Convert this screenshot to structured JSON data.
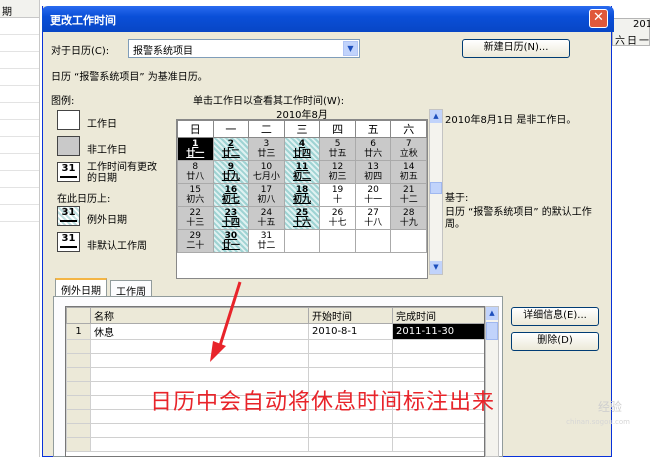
{
  "background": {
    "left_header": "期",
    "right_header_top": "201",
    "right_header_days": [
      "六",
      "日",
      "一"
    ]
  },
  "dialog": {
    "title": "更改工作时间",
    "close_glyph": "✕",
    "for_calendar_label": "对于日历(C):",
    "calendar_select_value": "报警系统项目",
    "new_calendar_button": "新建日历(N)...",
    "base_calendar_text": "日历 “报警系统项目” 为基准日历。",
    "legend_title": "图例:",
    "legend": {
      "working_day": "工作日",
      "nonworking_day": "非工作日",
      "edited_hours": "工作时间有更改的日期",
      "on_this_calendar": "在此日历上:",
      "exception_day": "例外日期",
      "nondefault_week": "非默认工作周",
      "marker": "31"
    },
    "click_instruction": "单击工作日以查看其工作时间(W):",
    "month_title": "2010年8月",
    "weekdays": [
      "日",
      "一",
      "二",
      "三",
      "四",
      "五",
      "六"
    ],
    "weeks": [
      [
        {
          "d": "1",
          "l": "廿一",
          "s": "black"
        },
        {
          "d": "2",
          "l": "廿二",
          "s": "teal"
        },
        {
          "d": "3",
          "l": "廿三",
          "s": "gray"
        },
        {
          "d": "4",
          "l": "廿四",
          "s": "teal"
        },
        {
          "d": "5",
          "l": "廿五",
          "s": "gray"
        },
        {
          "d": "6",
          "l": "廿六",
          "s": "gray"
        },
        {
          "d": "7",
          "l": "立秋",
          "s": "gray"
        }
      ],
      [
        {
          "d": "8",
          "l": "廿八",
          "s": "gray"
        },
        {
          "d": "9",
          "l": "廿九",
          "s": "teal"
        },
        {
          "d": "10",
          "l": "七月小",
          "s": "gray"
        },
        {
          "d": "11",
          "l": "初二",
          "s": "teal"
        },
        {
          "d": "12",
          "l": "初三",
          "s": "gray"
        },
        {
          "d": "13",
          "l": "初四",
          "s": "gray"
        },
        {
          "d": "14",
          "l": "初五",
          "s": "gray"
        }
      ],
      [
        {
          "d": "15",
          "l": "初六",
          "s": "gray"
        },
        {
          "d": "16",
          "l": "初七",
          "s": "teal"
        },
        {
          "d": "17",
          "l": "初八",
          "s": "gray"
        },
        {
          "d": "18",
          "l": "初九",
          "s": "teal"
        },
        {
          "d": "19",
          "l": "十",
          "s": "work"
        },
        {
          "d": "20",
          "l": "十一",
          "s": "work"
        },
        {
          "d": "21",
          "l": "十二",
          "s": "gray"
        }
      ],
      [
        {
          "d": "22",
          "l": "十三",
          "s": "gray"
        },
        {
          "d": "23",
          "l": "十四",
          "s": "teal"
        },
        {
          "d": "24",
          "l": "十五",
          "s": "gray"
        },
        {
          "d": "25",
          "l": "十六",
          "s": "teal"
        },
        {
          "d": "26",
          "l": "十七",
          "s": "work"
        },
        {
          "d": "27",
          "l": "十八",
          "s": "work"
        },
        {
          "d": "28",
          "l": "十九",
          "s": "gray"
        }
      ],
      [
        {
          "d": "29",
          "l": "二十",
          "s": "gray"
        },
        {
          "d": "30",
          "l": "廿一",
          "s": "teal"
        },
        {
          "d": "31",
          "l": "廿二",
          "s": "work"
        },
        {
          "d": "",
          "l": "",
          "s": "empty"
        },
        {
          "d": "",
          "l": "",
          "s": "empty"
        },
        {
          "d": "",
          "l": "",
          "s": "empty"
        },
        {
          "d": "",
          "l": "",
          "s": "empty"
        }
      ]
    ],
    "selected_date_info": "2010年8月1日 是非工作日。",
    "based_on_label": "基于:",
    "based_on_text": "日历 “报警系统项目” 的默认工作周。",
    "tabs": [
      "例外日期",
      "工作周"
    ],
    "grid_headers": [
      "",
      "名称",
      "开始时间",
      "完成时间"
    ],
    "grid_rows": [
      {
        "num": "1",
        "name": "休息",
        "start": "2010-8-1",
        "finish": "2011-11-30"
      }
    ],
    "details_button": "详细信息(E)...",
    "delete_button": "删除(D)"
  },
  "annotation": "日历中会自动将休息时间标注出来",
  "watermark": "经验",
  "watermark_sub": "chinan.sogou.com",
  "colors": {
    "annotation": "#e8242a",
    "titlebar": "#0a4fd8",
    "teal": "#9fd3d3"
  }
}
